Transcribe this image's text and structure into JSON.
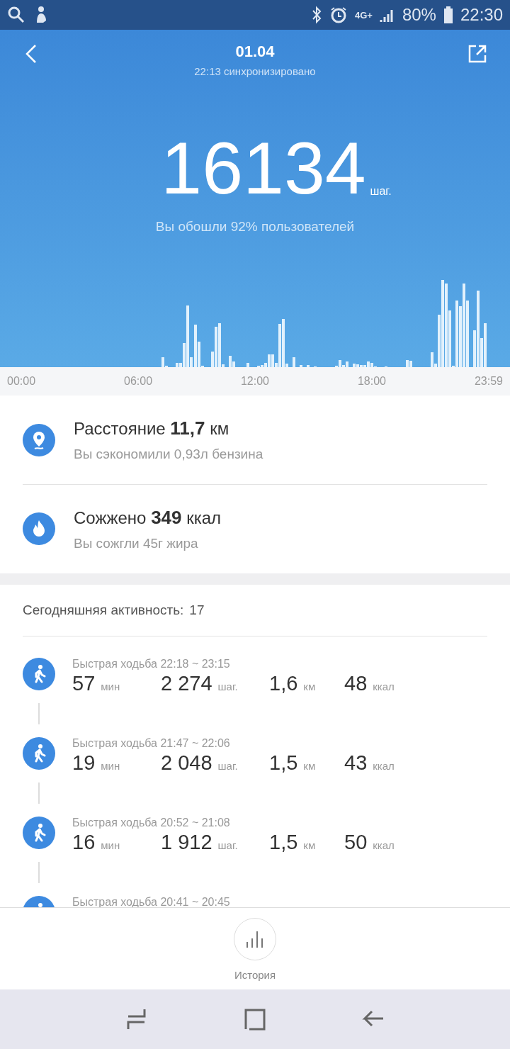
{
  "status_bar": {
    "network": "4G+",
    "battery": "80%",
    "time": "22:30"
  },
  "header": {
    "title": "01.04",
    "subtitle": "22:13 синхронизировано"
  },
  "steps": {
    "value": "16134",
    "unit": "шаг.",
    "note": "Вы обошли 92% пользователей"
  },
  "axis_labels": [
    "00:00",
    "06:00",
    "12:00",
    "18:00",
    "23:59"
  ],
  "stats": [
    {
      "kind": "distance",
      "headline": "Расстояние **11,7** км",
      "note": "Вы сэкономили 0,93л бензина"
    },
    {
      "kind": "calories",
      "headline": "Сожжено **349** ккал",
      "note": "Вы сожгли 45г жира"
    }
  ],
  "activity": {
    "label": "Сегодняшняя активность:",
    "count": "17",
    "items": [
      {
        "title": "Быстрая ходьба 22:18 ~ 23:15",
        "metrics": [
          {
            "value": "57",
            "unit": "мин"
          },
          {
            "value": "2 274",
            "unit": "шаг."
          },
          {
            "value": "1,6",
            "unit": "км"
          },
          {
            "value": "48",
            "unit": "ккал"
          }
        ]
      },
      {
        "title": "Быстрая ходьба 21:47 ~ 22:06",
        "metrics": [
          {
            "value": "19",
            "unit": "мин"
          },
          {
            "value": "2 048",
            "unit": "шаг."
          },
          {
            "value": "1,5",
            "unit": "км"
          },
          {
            "value": "43",
            "unit": "ккал"
          }
        ]
      },
      {
        "title": "Быстрая ходьба 20:52 ~ 21:08",
        "metrics": [
          {
            "value": "16",
            "unit": "мин"
          },
          {
            "value": "1 912",
            "unit": "шаг."
          },
          {
            "value": "1,5",
            "unit": "км"
          },
          {
            "value": "50",
            "unit": "ккал"
          }
        ]
      },
      {
        "title": "Быстрая ходьба 20:41 ~ 20:45"
      }
    ]
  },
  "bottom": {
    "label": "История"
  }
}
